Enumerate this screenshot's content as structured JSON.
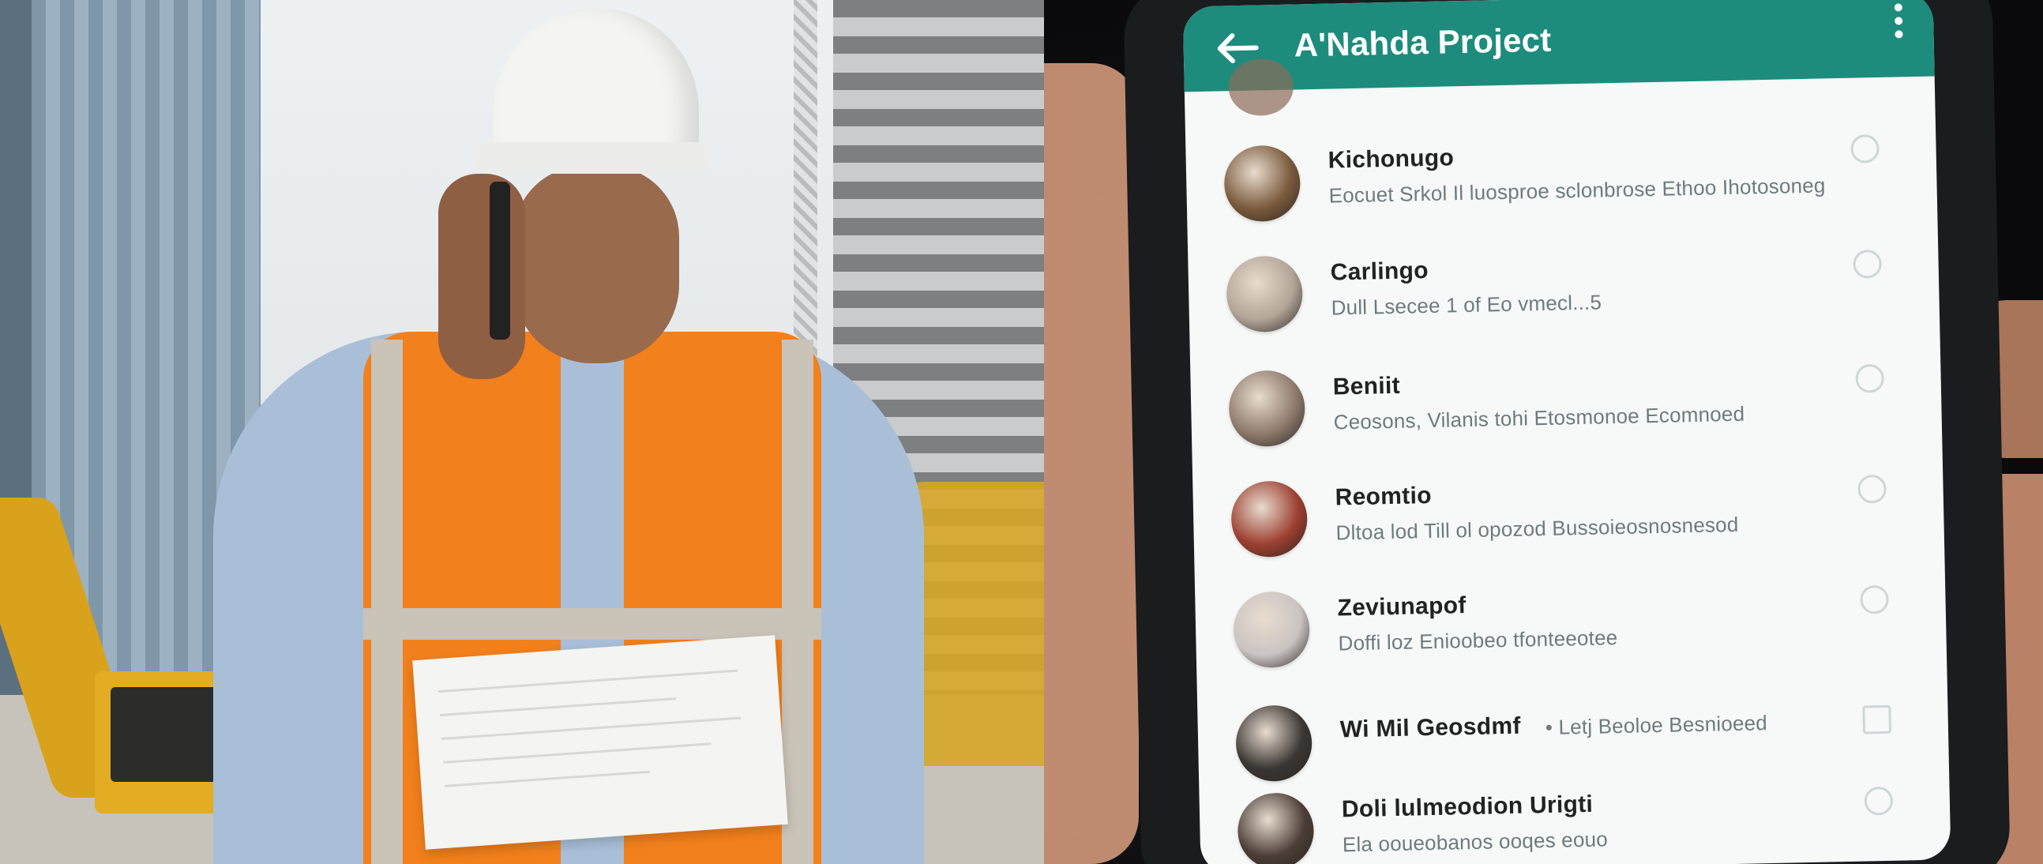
{
  "app": {
    "title": "A'Nahda Project"
  },
  "chats": [
    {
      "name": "Kichonugo",
      "preview": "Eocuet Srkol Il luosproe sclonbrose Ethoo Ihotosoneg",
      "avatar_color": "#7a5a3c"
    },
    {
      "name": "Carlingo",
      "preview": "Dull Lsecee 1 of Eo vmecl...5",
      "avatar_color": "#b2a497"
    },
    {
      "name": "Beniit",
      "preview": "Ceosons, Vilanis tohi Etosmonoe Ecomnoed",
      "avatar_color": "#8d7a6c"
    },
    {
      "name": "Reomtio",
      "preview": "Dltoa lod Till ol opozod Bussoieosnosnesod",
      "avatar_color": "#9c3f30"
    },
    {
      "name": "Zeviunapof",
      "preview": "Doffi loz Enioobeo tfonteeotee",
      "avatar_color": "#c9c4c2"
    },
    {
      "name": "Wi Mil Geosdmf",
      "preview": "• Letj Beoloe Besnioeed",
      "avatar_color": "#3a3633"
    },
    {
      "name": "Doli lulmeodion Urigti",
      "preview": "Ela ooueobanos ooqes eouo",
      "avatar_color": "#4b3d36"
    }
  ],
  "colors": {
    "appbar": "#1d8c7c",
    "vest": "#f2801c",
    "helmet": "#f4f5f3"
  }
}
